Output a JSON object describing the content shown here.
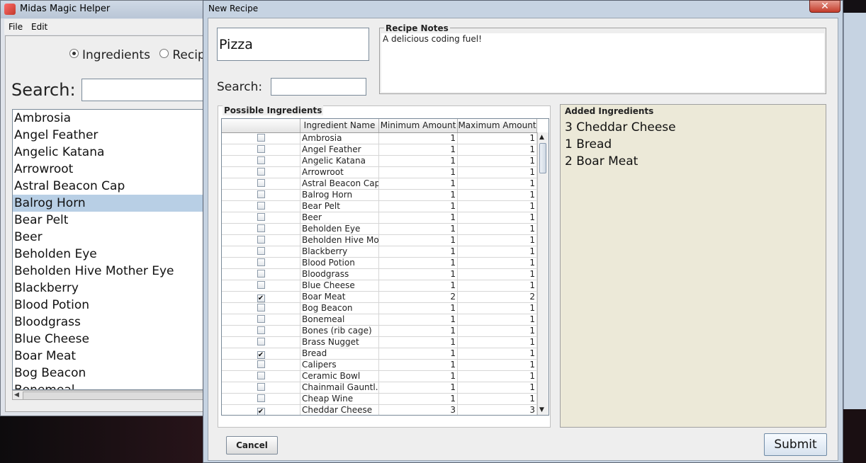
{
  "main_window": {
    "title": "Midas Magic Helper",
    "menu": [
      "File",
      "Edit"
    ],
    "mode_options": [
      {
        "label": "Ingredients",
        "selected": true
      },
      {
        "label": "Recipes",
        "selected": false
      }
    ],
    "search_label": "Search:",
    "search_value": "",
    "list_items": [
      "Ambrosia",
      "Angel Feather",
      "Angelic Katana",
      "Arrowroot",
      "Astral Beacon Cap",
      "Balrog Horn",
      "Bear Pelt",
      "Beer",
      "Beholden Eye",
      "Beholden Hive Mother Eye",
      "Blackberry",
      "Blood Potion",
      "Bloodgrass",
      "Blue Cheese",
      "Boar Meat",
      "Bog Beacon",
      "Bonemeal"
    ],
    "selected_item": "Balrog Horn"
  },
  "dialog": {
    "title": "New Recipe",
    "close_label": "✕",
    "recipe_name": "Pizza",
    "search_label": "Search:",
    "search_value": "",
    "notes_label": "Recipe Notes",
    "notes_text": "A delicious coding fuel!",
    "possible_label": "Possible Ingredients",
    "columns": [
      "",
      "Ingredient Name",
      "Minimum Amount",
      "Maximum Amount"
    ],
    "rows": [
      {
        "checked": false,
        "name": "Ambrosia",
        "min": 1,
        "max": 1
      },
      {
        "checked": false,
        "name": "Angel Feather",
        "min": 1,
        "max": 1
      },
      {
        "checked": false,
        "name": "Angelic Katana",
        "min": 1,
        "max": 1
      },
      {
        "checked": false,
        "name": "Arrowroot",
        "min": 1,
        "max": 1
      },
      {
        "checked": false,
        "name": "Astral Beacon Cap",
        "min": 1,
        "max": 1
      },
      {
        "checked": false,
        "name": "Balrog Horn",
        "min": 1,
        "max": 1
      },
      {
        "checked": false,
        "name": "Bear Pelt",
        "min": 1,
        "max": 1
      },
      {
        "checked": false,
        "name": "Beer",
        "min": 1,
        "max": 1
      },
      {
        "checked": false,
        "name": "Beholden Eye",
        "min": 1,
        "max": 1
      },
      {
        "checked": false,
        "name": "Beholden Hive Mo...",
        "min": 1,
        "max": 1
      },
      {
        "checked": false,
        "name": "Blackberry",
        "min": 1,
        "max": 1
      },
      {
        "checked": false,
        "name": "Blood Potion",
        "min": 1,
        "max": 1
      },
      {
        "checked": false,
        "name": "Bloodgrass",
        "min": 1,
        "max": 1
      },
      {
        "checked": false,
        "name": "Blue Cheese",
        "min": 1,
        "max": 1
      },
      {
        "checked": true,
        "name": "Boar Meat",
        "min": 2,
        "max": 2
      },
      {
        "checked": false,
        "name": "Bog Beacon",
        "min": 1,
        "max": 1
      },
      {
        "checked": false,
        "name": "Bonemeal",
        "min": 1,
        "max": 1
      },
      {
        "checked": false,
        "name": "Bones (rib cage)",
        "min": 1,
        "max": 1
      },
      {
        "checked": false,
        "name": "Brass Nugget",
        "min": 1,
        "max": 1
      },
      {
        "checked": true,
        "name": "Bread",
        "min": 1,
        "max": 1
      },
      {
        "checked": false,
        "name": "Calipers",
        "min": 1,
        "max": 1
      },
      {
        "checked": false,
        "name": "Ceramic Bowl",
        "min": 1,
        "max": 1
      },
      {
        "checked": false,
        "name": "Chainmail Gauntl...",
        "min": 1,
        "max": 1
      },
      {
        "checked": false,
        "name": "Cheap Wine",
        "min": 1,
        "max": 1
      },
      {
        "checked": true,
        "name": "Cheddar Cheese",
        "min": 3,
        "max": 3
      }
    ],
    "added_label": "Added Ingredients",
    "added_items": [
      "3 Cheddar Cheese",
      "1 Bread",
      "2 Boar Meat"
    ],
    "cancel_label": "Cancel",
    "submit_label": "Submit"
  },
  "icons": {
    "check_glyph": "✔",
    "scroll_up": "▲",
    "scroll_down": "▼",
    "scroll_left": "◀"
  }
}
